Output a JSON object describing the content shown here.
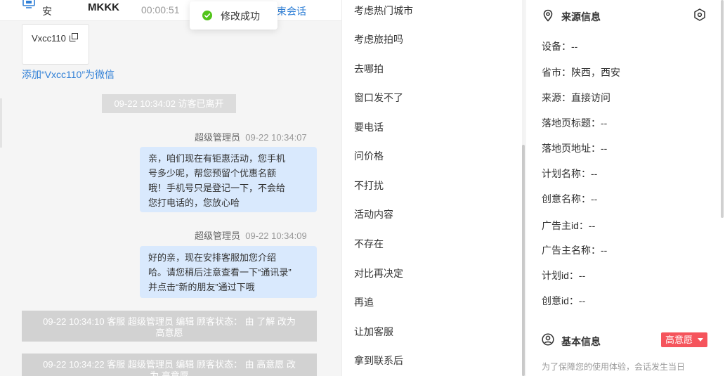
{
  "header": {
    "visitor_name": "安",
    "agent_name": "MKKK",
    "timer": "00:00:51",
    "end_session_label": "结束会话"
  },
  "toast": {
    "text": "修改成功"
  },
  "chat": {
    "wechat_card": {
      "wechat_id": "Vxcc110"
    },
    "add_wechat_link": "添加“Vxcc110”为微信",
    "system_notice": "09-22 10:34:02 访客已离开",
    "messages": [
      {
        "sender": "超级管理员",
        "time": "09-22 10:34:07",
        "lines": [
          "亲，咱们现在有钜惠活动，您手机",
          "号多少呢，帮您预留个优惠名额",
          "哦！手机号只是登记一下，不会给",
          "您打电话的，您放心哈"
        ]
      },
      {
        "sender": "超级管理员",
        "time": "09-22 10:34:09",
        "lines": [
          "好的亲，现在安排客服加您介绍",
          "哈。请您稍后注意查看一下“通讯录”",
          "并点击“新的朋友”通过下哦"
        ]
      }
    ],
    "status_logs": [
      {
        "line1": "09-22 10:34:10 客服 超级管理员 编辑 顾客状态： 由 了解 改为",
        "line2": "高意愿"
      },
      {
        "line1": "09-22 10:34:22 客服 超级管理员 编辑 顾客状态： 由 高意愿 改",
        "line2": "为 高意愿"
      }
    ]
  },
  "quick_replies": [
    "考虑热门城市",
    "考虑旅拍吗",
    "去哪拍",
    "窗口发不了",
    "要电话",
    "问价格",
    "不打扰",
    "活动内容",
    "不存在",
    "对比再决定",
    "再追",
    "让加客服",
    "拿到联系后"
  ],
  "source_info": {
    "title": "来源信息",
    "rows": [
      {
        "label": "设备：",
        "value": "--"
      },
      {
        "label": "省市：",
        "value": "陕西，西安"
      },
      {
        "label": "来源：",
        "value": "直接访问"
      },
      {
        "label": "落地页标题：",
        "value": "--"
      },
      {
        "label": "落地页地址：",
        "value": "--"
      },
      {
        "label": "计划名称：",
        "value": "--"
      },
      {
        "label": "创意名称：",
        "value": "--"
      },
      {
        "label": "广告主id：",
        "value": "--"
      },
      {
        "label": "广告主名称：",
        "value": "--"
      },
      {
        "label": "计划id：",
        "value": "--"
      },
      {
        "label": "创意id：",
        "value": "--"
      }
    ]
  },
  "basic_info": {
    "title": "基本信息",
    "intent_label": "高意愿",
    "note": "为了保障您的使用体验，会话发生当日"
  },
  "colors": {
    "accent_blue": "#2f7fd6",
    "bubble_blue": "#d9e9fd",
    "badge_red": "#f5545c",
    "success_green": "#52c41a"
  },
  "icons": [
    "monitor-icon",
    "check-circle-icon",
    "copy-icon",
    "location-pin-icon",
    "hexagon-settings-icon",
    "user-circle-icon"
  ]
}
